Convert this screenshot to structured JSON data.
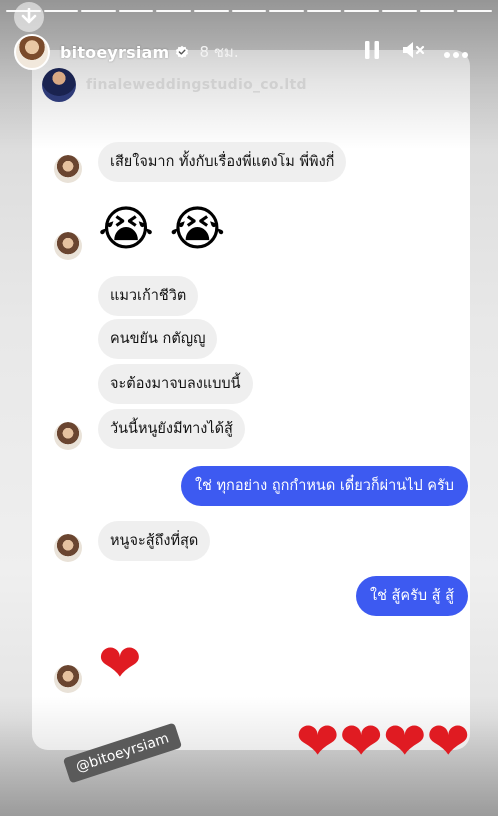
{
  "story": {
    "username": "bitoeyrsiam",
    "time": "8 ชม.",
    "segments": 13,
    "mention": "@bitoeyrsiam"
  },
  "chat": {
    "contact_name": "finaleweddingstudio_co.ltd",
    "messages": [
      {
        "from": "them",
        "text": "เสียใจมาก ทั้งกับเรื่องพี่แตงโม พี่พิงกี่"
      },
      {
        "from": "them",
        "text": "😭 😭"
      },
      {
        "from": "them",
        "text": "แมวเก้าชีวิต"
      },
      {
        "from": "them",
        "text": "คนขยัน กตัญญู"
      },
      {
        "from": "them",
        "text": "จะต้องมาจบลงแบบนี้"
      },
      {
        "from": "them",
        "text": "วันนี้หนูยังมีทางได้สู้"
      },
      {
        "from": "me",
        "text": "ใช่  ทุกอย่าง ถูกกำหนด เดี๋ยวก็ผ่านไป ครับ"
      },
      {
        "from": "them",
        "text": "หนูจะสู้ถึงที่สุด"
      },
      {
        "from": "me",
        "text": "ใช่  สู้ครับ สู้ สู้"
      },
      {
        "from": "them",
        "text": "❤"
      }
    ],
    "hearts_row": "❤❤❤❤"
  },
  "icons": {
    "down": "download-arrow-icon",
    "pause": "pause-icon",
    "mute": "mute-icon",
    "more": "more-icon",
    "verified": "verified-badge-icon"
  },
  "colors": {
    "sent_bubble": "#3d5af1",
    "received_bubble": "#efefef",
    "heart": "#e01b22"
  }
}
